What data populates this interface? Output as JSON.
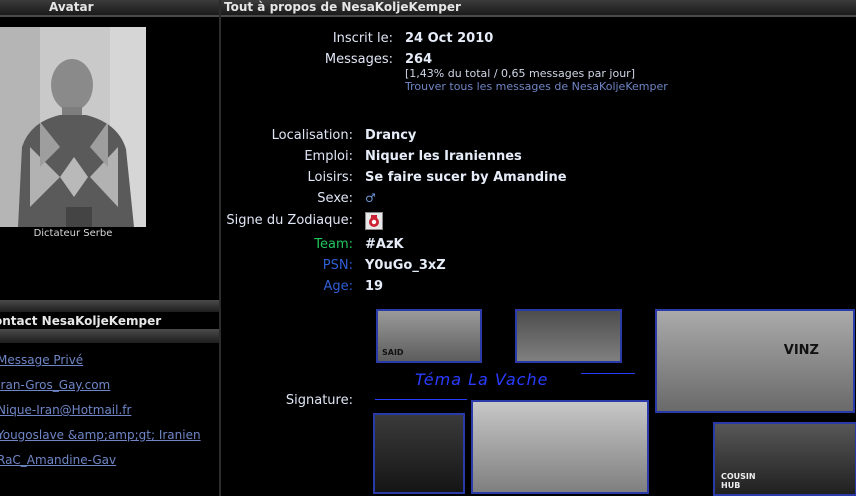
{
  "left": {
    "header": "Avatar",
    "avatar_caption": "Dictateur Serbe",
    "contact_title": "ontact NesaKoljeKemper",
    "contacts": [
      "Message Privé",
      "Iran-Gros_Gay.com",
      "Nique-Iran@Hotmail.fr",
      "Yougoslave &amp;amp;gt; Iranien",
      "RaC_Amandine-Gav"
    ]
  },
  "right": {
    "header": "Tout à propos de NesaKoljeKemper",
    "inscrit_label": "Inscrit le:",
    "inscrit_value": "24 Oct 2010",
    "messages_label": "Messages:",
    "messages_value": "264",
    "messages_sub": "[1,43% du total / 0,65 messages par jour]",
    "messages_link": "Trouver tous les messages de NesaKoljeKemper",
    "localisation_label": "Localisation:",
    "localisation_value": "Drancy",
    "emploi_label": "Emploi:",
    "emploi_value": "Niquer les Iraniennes",
    "loisirs_label": "Loisirs:",
    "loisirs_value": "Se faire sucer by Amandine",
    "sexe_label": "Sexe:",
    "sexe_icon": "male-icon",
    "zodiac_label": "Signe du Zodiaque:",
    "zodiac_icon": "zodiac-cancer-icon",
    "team_label": "Team:",
    "team_value": "#AzK",
    "psn_label": "PSN:",
    "psn_value": "Y0uGo_3xZ",
    "age_label": "Age:",
    "age_value": "19",
    "signature_label": "Signature:",
    "signature_caption": "Téma La Vache",
    "sig_labels": [
      "SAID",
      "VINZ",
      "COUSIN HUB"
    ]
  },
  "colors": {
    "link": "#6f86c6",
    "team": "#22c55e",
    "psn": "#2f5fd6",
    "sig_border": "#2a3aa8"
  }
}
